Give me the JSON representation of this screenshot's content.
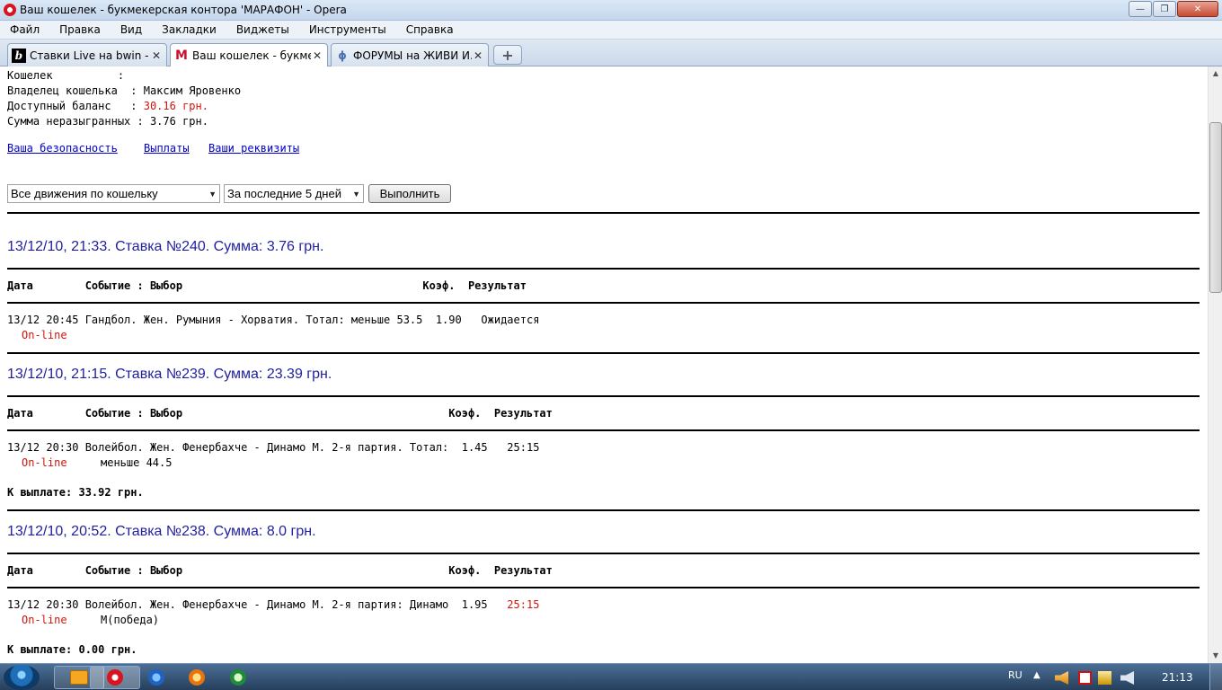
{
  "window": {
    "title": "Ваш кошелек - букмекерская контора 'МАРАФОН' - Opera",
    "min_glyph": "—",
    "max_glyph": "❐",
    "close_glyph": "✕"
  },
  "menu": [
    "Файл",
    "Правка",
    "Вид",
    "Закладки",
    "Виджеты",
    "Инструменты",
    "Справка"
  ],
  "tabs": [
    {
      "label": "Ставки Live на bwin - ...",
      "icon": "bwin-icon",
      "fav": "b",
      "active": false
    },
    {
      "label": "Ваш кошелек - букме...",
      "icon": "marathon-icon",
      "fav": "M",
      "active": true
    },
    {
      "label": "ФОРУМЫ на ЖИВИ И...",
      "icon": "forum-icon",
      "fav": "ɸ",
      "active": false
    }
  ],
  "tab_close_glyph": "✕",
  "new_tab_glyph": "+",
  "wallet": {
    "line1": "Кошелек          :",
    "line2": "Владелец кошелька  : Максим Яровенко",
    "line3_label": "Доступный баланс   : ",
    "line3_value": "30.16 грн.",
    "line4": "Сумма неразыгранных : 3.76 грн."
  },
  "links": [
    "Ваша безопасность",
    "Выплаты",
    "Ваши реквизиты"
  ],
  "filters": {
    "type_select": "Все движения по кошельку",
    "period_select": "За последние 5 дней",
    "submit": "Выполнить",
    "arrow": "▼"
  },
  "bets": [
    {
      "header": "13/12/10, 21:33. Ставка №240. Сумма: 3.76 грн.",
      "col_header": "Дата        Событие : Выбор                                     Коэф.  Результат",
      "row_line1": "13/12 20:45 Гандбол. Жен. Румыния - Хорватия. Тотал: меньше 53.5  1.90   Ожидается",
      "online": "On-line",
      "row_line2": "",
      "payout": ""
    },
    {
      "header": "13/12/10, 21:15. Ставка №239. Сумма: 23.39 грн.",
      "col_header": "Дата        Событие : Выбор                                         Коэф.  Результат",
      "row_line1": "13/12 20:30 Волейбол. Жен. Фенербахче - Динамо М. 2-я партия. Тотал:  1.45   25:15",
      "online": "On-line",
      "row_line2": "меньше 44.5",
      "payout": "К выплате: 33.92 грн."
    },
    {
      "header": "13/12/10, 20:52. Ставка №238. Сумма: 8.0 грн.",
      "col_header": "Дата        Событие : Выбор                                         Коэф.  Результат",
      "row_line1_main": "13/12 20:30 Волейбол. Жен. Фенербахче - Динамо М. 2-я партия: Динамо  1.95   ",
      "row_line1_result": "25:15",
      "online": "On-line",
      "row_line2": "М(победа)",
      "payout": "К выплате: 0.00 грн."
    }
  ],
  "scroll": {
    "up": "▲",
    "down": "▼"
  },
  "taskbar": {
    "lang": "RU",
    "tray_arrow": "▲",
    "clock": "21:13"
  },
  "colors": {
    "accent_red": "#d0150c",
    "link_blue": "#0000cc",
    "heading_blue": "#1f1fa0"
  }
}
